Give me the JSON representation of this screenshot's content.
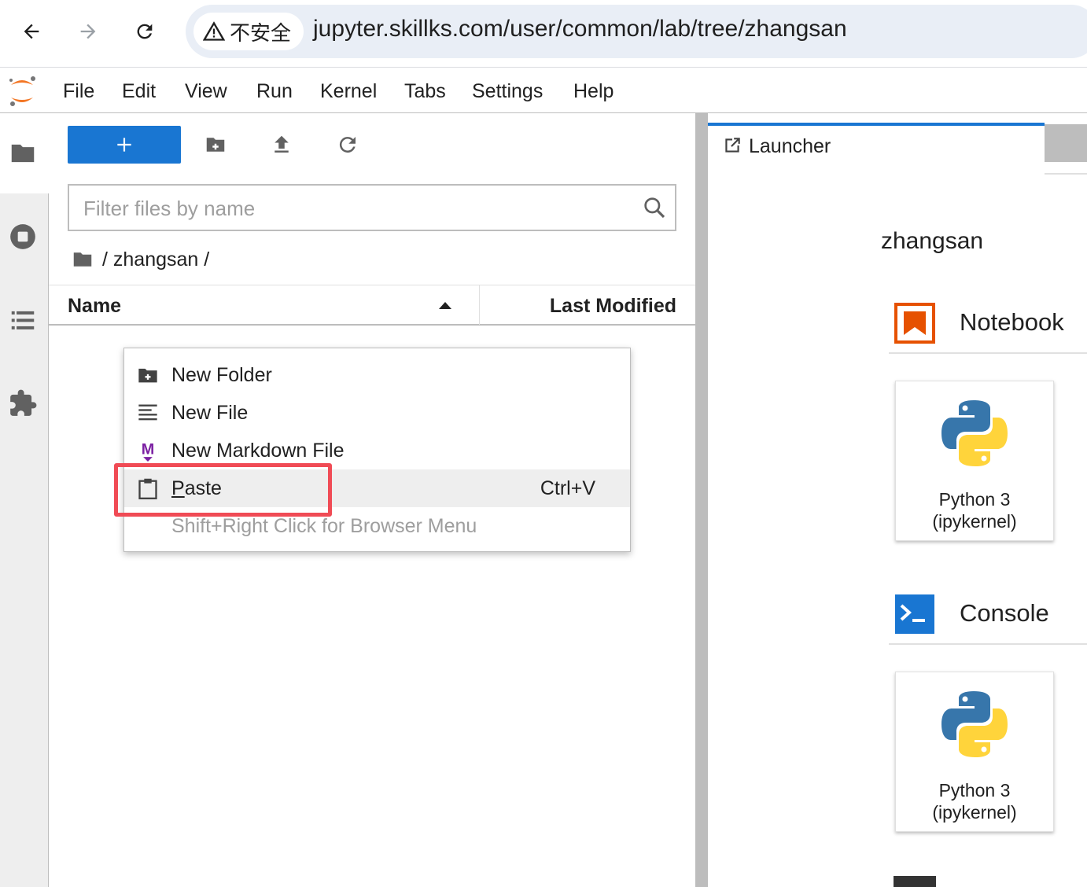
{
  "browser": {
    "security_label": "不安全",
    "url": "jupyter.skillks.com/user/common/lab/tree/zhangsan"
  },
  "menubar": {
    "items": [
      "File",
      "Edit",
      "View",
      "Run",
      "Kernel",
      "Tabs",
      "Settings",
      "Help"
    ]
  },
  "file_browser": {
    "filter_placeholder": "Filter files by name",
    "breadcrumb": "/ zhangsan /",
    "columns": {
      "name": "Name",
      "last_modified": "Last Modified"
    }
  },
  "context_menu": {
    "items": [
      {
        "label": "New Folder",
        "icon": "new-folder-icon"
      },
      {
        "label": "New File",
        "icon": "text-file-icon"
      },
      {
        "label": "New Markdown File",
        "icon": "markdown-icon"
      },
      {
        "label_accel": "P",
        "label_rest": "aste",
        "shortcut": "Ctrl+V",
        "icon": "paste-icon",
        "active": true
      }
    ],
    "hint": "Shift+Right Click for Browser Menu"
  },
  "launcher": {
    "tab_label": "Launcher",
    "cwd": "zhangsan",
    "notebook_title": "Notebook",
    "console_title": "Console",
    "kernel_line1": "Python 3",
    "kernel_line2": "(ipykernel)"
  },
  "colors": {
    "accent": "#1976d2",
    "highlight": "#f04b55",
    "notebook_orange": "#e65100"
  }
}
